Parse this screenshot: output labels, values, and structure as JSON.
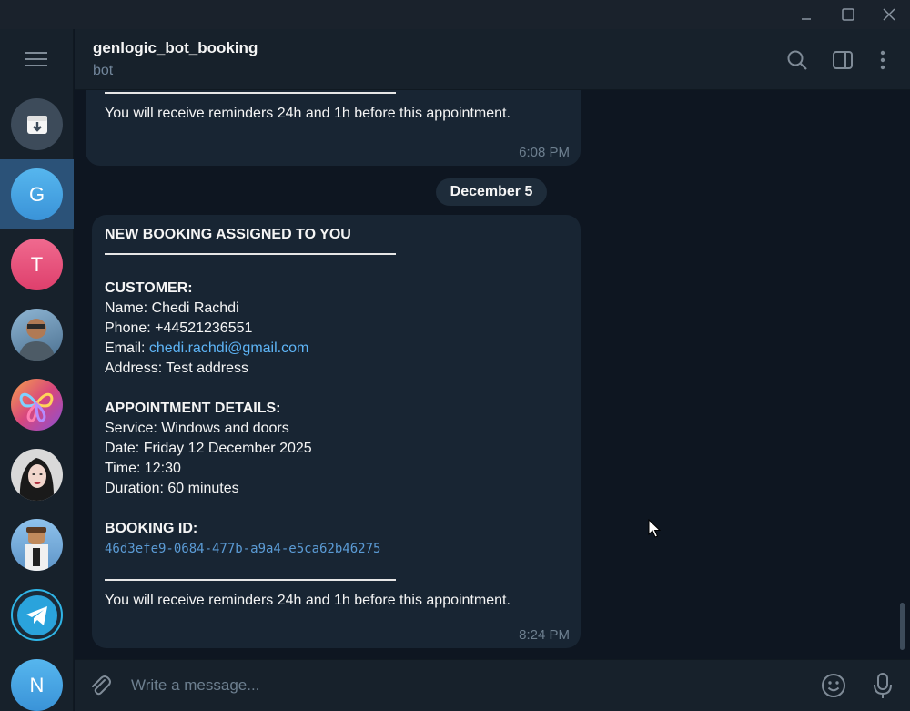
{
  "window": {
    "controls": [
      "minimize-icon",
      "maximize-icon",
      "close-icon"
    ]
  },
  "sidebar": {
    "menu_icon": "hamburger-menu-icon",
    "chats": [
      {
        "kind": "archive",
        "icon": "archive-icon",
        "color": "#3d4b5a"
      },
      {
        "kind": "letter",
        "letter": "G",
        "color": "#3b9ee6",
        "active": true
      },
      {
        "kind": "letter",
        "letter": "T",
        "color": "#e5487a"
      },
      {
        "kind": "photo",
        "icon": "person-photo-avatar",
        "color": "#4a7fa8"
      },
      {
        "kind": "photo",
        "icon": "butterfly-logo-avatar",
        "color": "#d85a8a"
      },
      {
        "kind": "photo",
        "icon": "person-photo-avatar",
        "color": "#cfcfcf"
      },
      {
        "kind": "photo",
        "icon": "cartoon-character-avatar",
        "color": "#6aa0d0"
      },
      {
        "kind": "photo",
        "icon": "telegram-logo-avatar",
        "color": "#2aa0d8"
      },
      {
        "kind": "letter",
        "letter": "N",
        "color": "#3b9ee6"
      }
    ]
  },
  "header": {
    "title": "genlogic_bot_booking",
    "subtitle": "bot",
    "icons": [
      "search-icon",
      "sidebar-toggle-icon",
      "more-vertical-icon"
    ]
  },
  "messages": {
    "previous": {
      "reminder": "You will receive reminders 24h and 1h before this appointment.",
      "time": "6:08 PM"
    },
    "date_separator": "December 5",
    "current": {
      "heading": "NEW BOOKING ASSIGNED TO YOU",
      "customer_heading": "CUSTOMER:",
      "name_line": "Name: Chedi Rachdi",
      "phone_line": "Phone: +44521236551",
      "email_label": "Email: ",
      "email": "chedi.rachdi@gmail.com",
      "address_line": "Address: Test address",
      "details_heading": "APPOINTMENT DETAILS:",
      "service_line": "Service: Windows and doors",
      "date_line": "Date: Friday 12 December 2025",
      "time_line": "Time: 12:30",
      "duration_line": "Duration: 60 minutes",
      "booking_heading": "BOOKING ID:",
      "booking_id": "46d3efe9-0684-477b-a9a4-e5ca62b46275",
      "reminder": "You will receive reminders 24h and 1h before this appointment.",
      "time": "8:24 PM"
    }
  },
  "composer": {
    "placeholder": "Write a message...",
    "icons": [
      "paperclip-icon",
      "emoji-icon",
      "microphone-icon"
    ]
  }
}
